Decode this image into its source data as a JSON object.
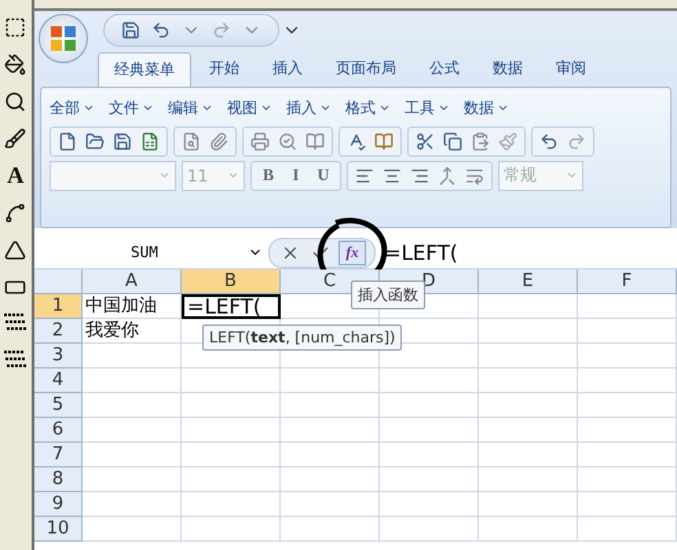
{
  "paint_tools": [
    {
      "kind": "select"
    },
    {
      "kind": "fill"
    },
    {
      "kind": "magnifier"
    },
    {
      "kind": "brush"
    },
    {
      "kind": "text",
      "label": "A"
    },
    {
      "kind": "curve"
    },
    {
      "kind": "polygon"
    },
    {
      "kind": "rounded"
    },
    {
      "kind": "spray"
    },
    {
      "kind": "spray"
    }
  ],
  "ribbon_tabs": [
    {
      "label": "经典菜单",
      "selected": true
    },
    {
      "label": "开始",
      "selected": false
    },
    {
      "label": "插入",
      "selected": false
    },
    {
      "label": "页面布局",
      "selected": false
    },
    {
      "label": "公式",
      "selected": false
    },
    {
      "label": "数据",
      "selected": false
    },
    {
      "label": "审阅",
      "selected": false
    }
  ],
  "classic_menu": [
    "全部",
    "文件",
    "编辑",
    "视图",
    "插入",
    "格式",
    "工具",
    "数据"
  ],
  "toolbar": {
    "font_size": "11",
    "format_buttons": [
      "B",
      "I",
      "U"
    ],
    "number_format": "常规"
  },
  "formula_bar": {
    "name_box": "SUM",
    "formula": "=LEFT(",
    "fx_label": "fx",
    "tooltip": "插入函数"
  },
  "sheet": {
    "columns": [
      {
        "label": "A",
        "selected": false
      },
      {
        "label": "B",
        "selected": true
      },
      {
        "label": "C",
        "selected": false
      },
      {
        "label": "D",
        "selected": false
      },
      {
        "label": "E",
        "selected": false
      },
      {
        "label": "F",
        "selected": false
      }
    ],
    "rows": [
      {
        "label": "1",
        "selected": true,
        "cells": [
          "中国加油",
          "=LEFT("
        ]
      },
      {
        "label": "2",
        "selected": false,
        "cells": [
          "我爱你"
        ]
      },
      {
        "label": "3",
        "selected": false,
        "cells": []
      },
      {
        "label": "4",
        "selected": false,
        "cells": []
      },
      {
        "label": "5",
        "selected": false,
        "cells": []
      },
      {
        "label": "6",
        "selected": false,
        "cells": []
      },
      {
        "label": "7",
        "selected": false,
        "cells": []
      },
      {
        "label": "8",
        "selected": false,
        "cells": []
      },
      {
        "label": "9",
        "selected": false,
        "cells": []
      },
      {
        "label": "10",
        "selected": false,
        "cells": []
      }
    ],
    "function_hint": "LEFT(**text**, [num_chars])"
  }
}
